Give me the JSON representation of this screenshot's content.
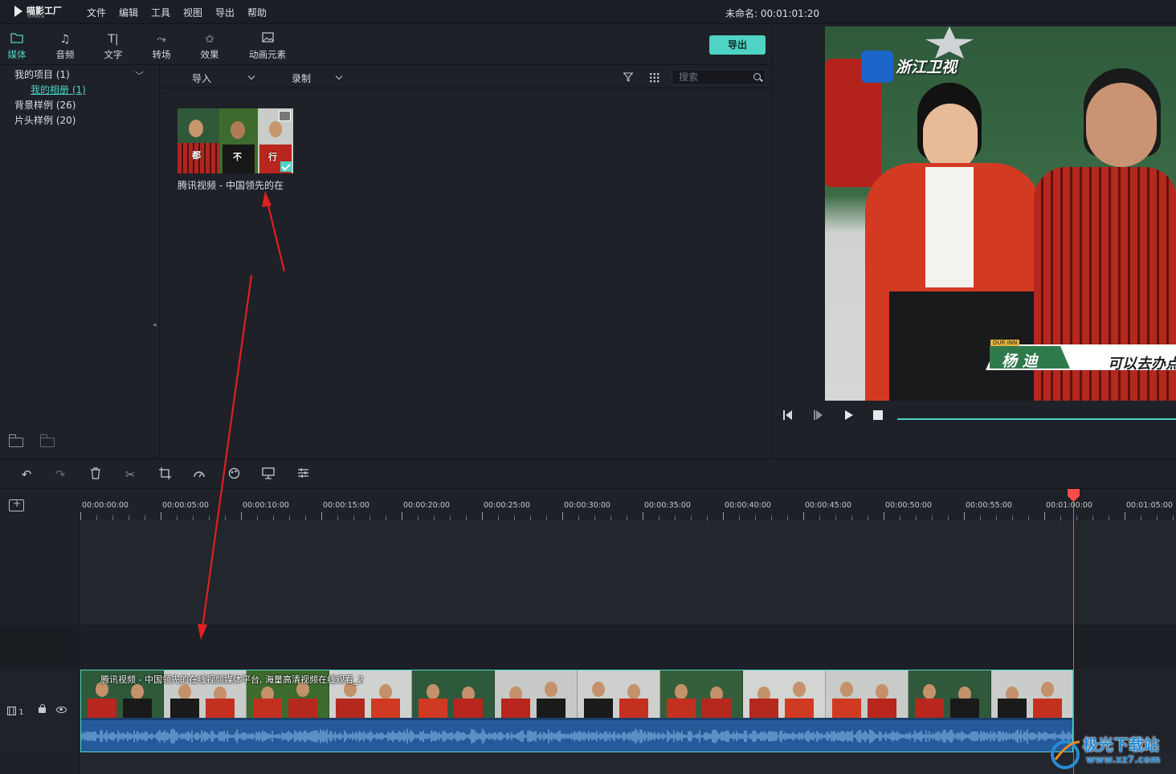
{
  "app": {
    "name": "喵影工厂",
    "sub": "filmora"
  },
  "menu": [
    "文件",
    "编辑",
    "工具",
    "视图",
    "导出",
    "帮助"
  ],
  "project_title": "未命名: 00:01:01:20",
  "tabs": [
    {
      "label": "媒体",
      "icon": "folder-icon",
      "active": true
    },
    {
      "label": "音频",
      "icon": "music-note-icon"
    },
    {
      "label": "文字",
      "icon": "text-icon"
    },
    {
      "label": "转场",
      "icon": "transition-icon"
    },
    {
      "label": "效果",
      "icon": "effects-icon"
    },
    {
      "label": "动画元素",
      "icon": "image-icon"
    }
  ],
  "export_label": "导出",
  "tree": {
    "items": [
      {
        "label": "我的项目 (1)"
      },
      {
        "label": "我的相册 (1)",
        "sub": true
      },
      {
        "label": "背景样例 (26)"
      },
      {
        "label": "片头样例 (20)"
      }
    ]
  },
  "media_toolbar": {
    "import_label": "导入",
    "record_label": "录制",
    "search_placeholder": "搜索"
  },
  "media_item": {
    "name": "腾讯视频 - 中国领先的在",
    "thumb_captions": [
      "都",
      "不",
      "行"
    ]
  },
  "preview": {
    "channel": "浙江卫视",
    "name_tag": "杨 迪",
    "caption": "可以去办点",
    "small_tag": "OUR INN"
  },
  "timeline": {
    "ticks": [
      "00:00:00:00",
      "00:00:05:00",
      "00:00:10:00",
      "00:00:15:00",
      "00:00:20:00",
      "00:00:25:00",
      "00:00:30:00",
      "00:00:35:00",
      "00:00:40:00",
      "00:00:45:00",
      "00:00:50:00",
      "00:00:55:00",
      "00:01:00:00",
      "00:01:05:00"
    ],
    "track_label": "1",
    "clip_title": "腾讯视频 - 中国领先的在线视频媒体平台, 海量高清视频在线观看_2"
  },
  "colors": {
    "accent": "#4fd3c4",
    "playhead": "#ff4b4b",
    "arrow": "#e02020"
  },
  "watermark": {
    "name": "极光下载站",
    "url": "www.xz7.com"
  }
}
